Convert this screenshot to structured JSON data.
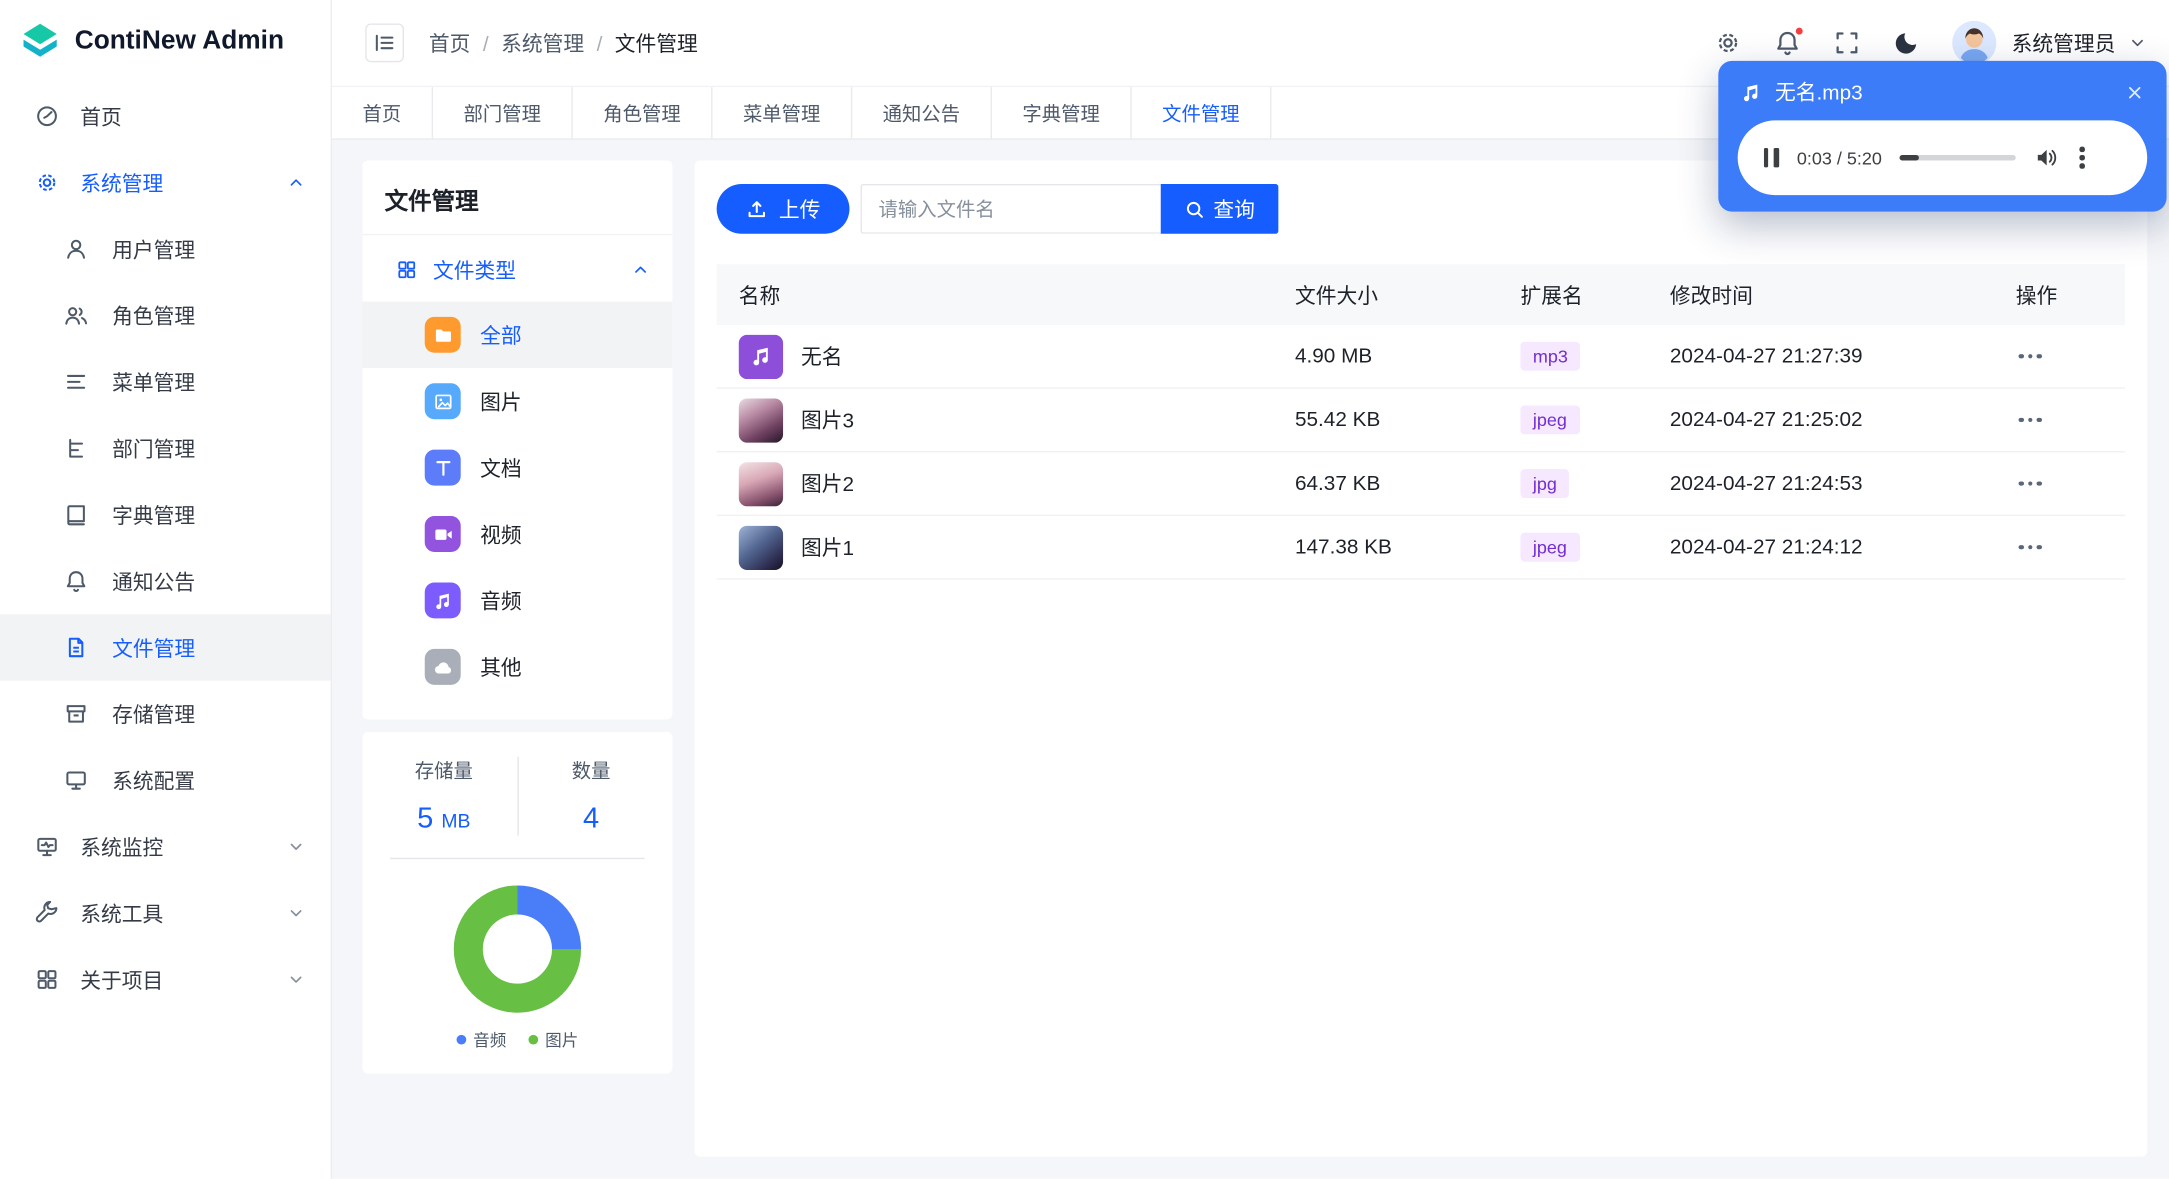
{
  "app": {
    "name": "ContiNew Admin"
  },
  "colors": {
    "primary": "#165DFF",
    "player_bg": "#3D7CF9",
    "badge_bg": "#F5E8FF",
    "badge_text": "#722ED1",
    "notification_dot": "#F53F3F",
    "active_row_bg": "#F2F3F5"
  },
  "header": {
    "breadcrumb": [
      "首页",
      "系统管理",
      "文件管理"
    ],
    "user": {
      "name": "系统管理员"
    }
  },
  "tabs": {
    "items": [
      "首页",
      "部门管理",
      "角色管理",
      "菜单管理",
      "通知公告",
      "字典管理",
      "文件管理"
    ],
    "active": "文件管理"
  },
  "sidebar": {
    "items": {
      "home": "首页",
      "system": "系统管理",
      "monitor": "系统监控",
      "tools": "系统工具",
      "about": "关于项目"
    },
    "system_children": [
      "用户管理",
      "角色管理",
      "菜单管理",
      "部门管理",
      "字典管理",
      "通知公告",
      "文件管理",
      "存储管理",
      "系统配置"
    ],
    "active_item": "文件管理"
  },
  "file_panel": {
    "title": "文件管理",
    "section": "文件类型",
    "types": [
      "全部",
      "图片",
      "文档",
      "视频",
      "音频",
      "其他"
    ],
    "active_type": "全部"
  },
  "stats": {
    "storage_label": "存储量",
    "storage_value": "5",
    "storage_unit": "MB",
    "count_label": "数量",
    "count_value": "4"
  },
  "toolbar": {
    "upload_label": "上传",
    "search_placeholder": "请输入文件名",
    "query_label": "查询"
  },
  "table": {
    "headers": [
      "名称",
      "文件大小",
      "扩展名",
      "修改时间",
      "操作"
    ],
    "rows": [
      {
        "name": "无名",
        "size": "4.90 MB",
        "ext": "mp3",
        "time": "2024-04-27 21:27:39"
      },
      {
        "name": "图片3",
        "size": "55.42 KB",
        "ext": "jpeg",
        "time": "2024-04-27 21:25:02"
      },
      {
        "name": "图片2",
        "size": "64.37 KB",
        "ext": "jpg",
        "time": "2024-04-27 21:24:53"
      },
      {
        "name": "图片1",
        "size": "147.38 KB",
        "ext": "jpeg",
        "time": "2024-04-27 21:24:12"
      }
    ]
  },
  "player": {
    "title": "无名.mp3",
    "time": "0:03 / 5:20"
  },
  "chart_data": {
    "type": "pie",
    "donut": true,
    "categories": [
      "音频",
      "图片"
    ],
    "values": [
      1,
      3
    ],
    "colors": [
      "#4A7DF8",
      "#67BF43"
    ],
    "legend_position": "bottom",
    "title": ""
  }
}
